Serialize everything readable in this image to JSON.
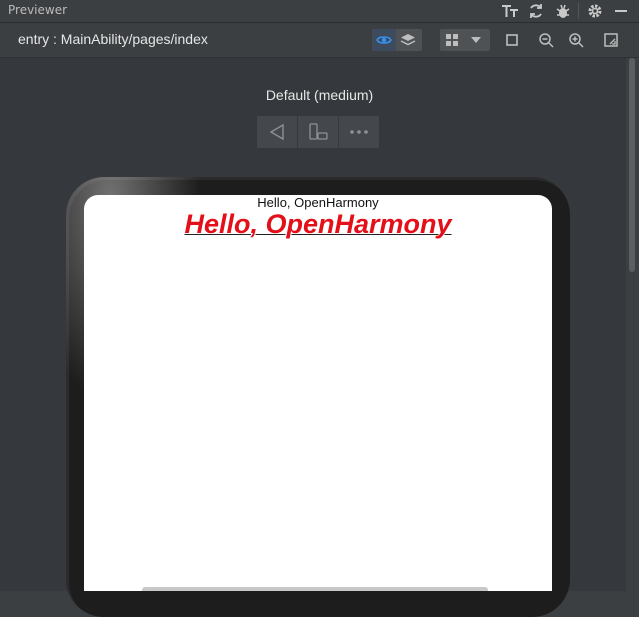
{
  "panel": {
    "title": "Previewer"
  },
  "toolbar": {
    "route": "entry : MainAbility/pages/index"
  },
  "device": {
    "label": "Default (medium)"
  },
  "app": {
    "small_text": "Hello, OpenHarmony",
    "big_text": "Hello, OpenHarmony",
    "big_text_color": "#e3101a"
  },
  "icons": {
    "titlebar": [
      "font-size-icon",
      "refresh-icon",
      "bug-icon",
      "settings-icon",
      "minimize-icon"
    ],
    "toolbar": [
      "inspector-eye-icon",
      "layers-icon",
      "grid-dropdown-icon",
      "fit-frame-icon",
      "zoom-out-icon",
      "zoom-in-icon",
      "fullscreen-icon"
    ],
    "device_controls": [
      "back-icon",
      "rotate-device-icon",
      "more-icon"
    ]
  }
}
